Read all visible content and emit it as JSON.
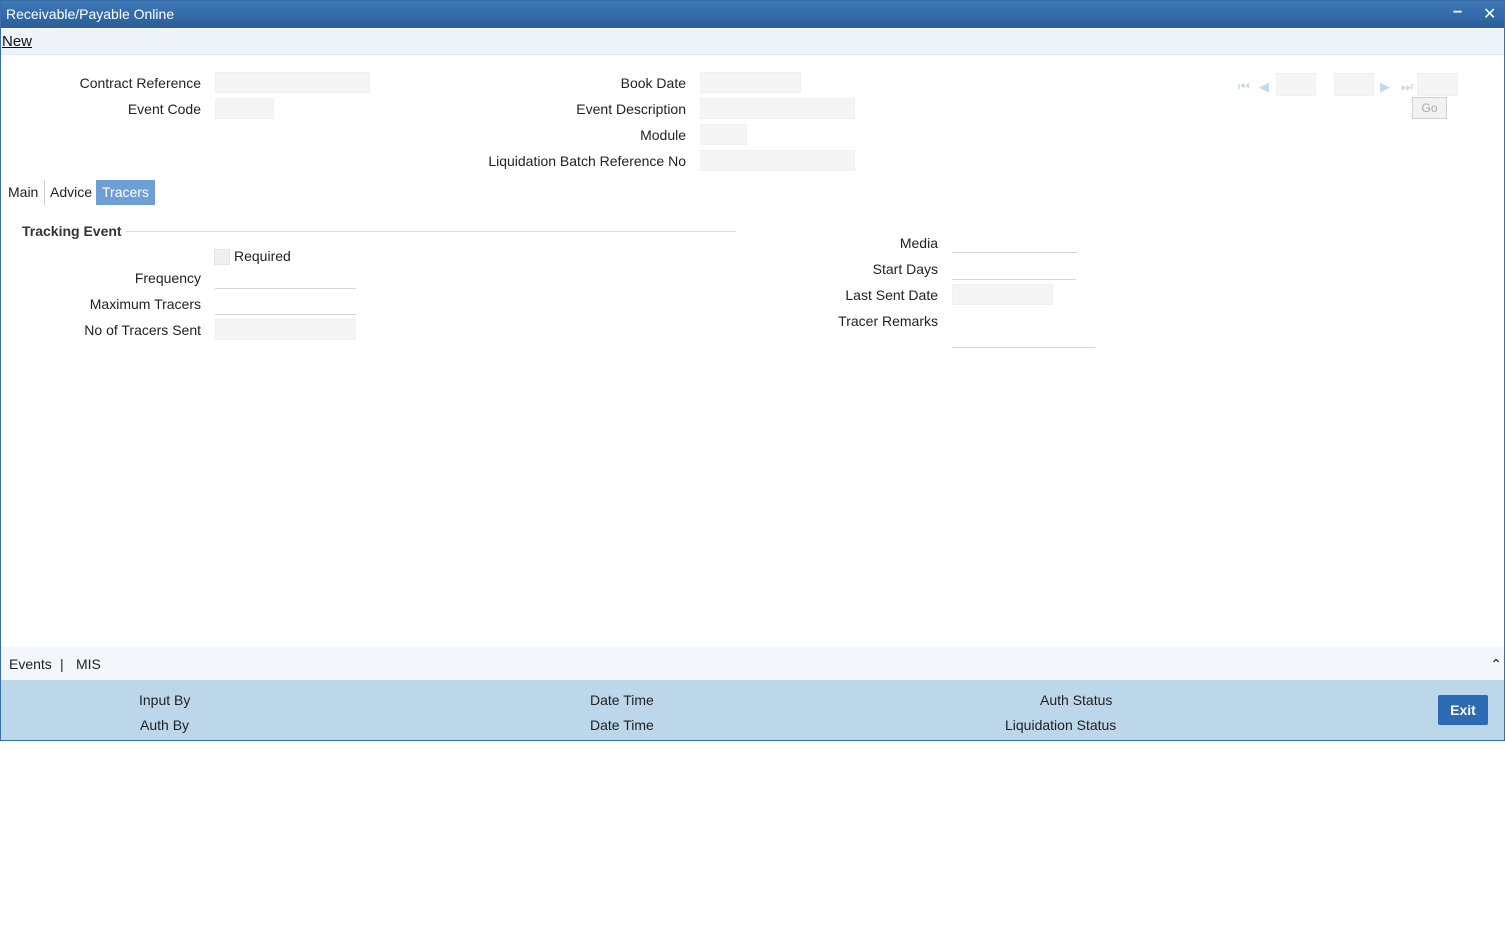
{
  "window": {
    "title": "Receivable/Payable Online",
    "minimize_glyph": "−",
    "close_glyph": "✕"
  },
  "menu": {
    "new_label": "New"
  },
  "header": {
    "contract_reference_label": "Contract Reference",
    "event_code_label": "Event Code",
    "book_date_label": "Book Date",
    "event_description_label": "Event Description",
    "module_label": "Module",
    "liquidation_batch_label": "Liquidation Batch Reference No",
    "contract_reference": "",
    "event_code": "",
    "book_date": "",
    "event_description": "",
    "module": "",
    "liquidation_batch": ""
  },
  "pager": {
    "current": "",
    "total": "",
    "goto": "",
    "go_label": "Go"
  },
  "tabs": [
    {
      "label": "Main"
    },
    {
      "label": "Advice"
    },
    {
      "label": "Tracers"
    }
  ],
  "tracers": {
    "section_title": "Tracking Event",
    "required_label": "Required",
    "required_checked": false,
    "frequency_label": "Frequency",
    "max_tracers_label": "Maximum Tracers",
    "tracers_sent_label": "No of Tracers Sent",
    "media_label": "Media",
    "start_days_label": "Start Days",
    "last_sent_date_label": "Last Sent Date",
    "tracer_remarks_label": "Tracer Remarks",
    "frequency": "",
    "max_tracers": "",
    "tracers_sent": "",
    "media": "",
    "start_days": "",
    "last_sent_date": "",
    "tracer_remarks": ""
  },
  "bottom_tabs": {
    "events": "Events",
    "separator": "|",
    "mis": "MIS"
  },
  "footer": {
    "input_by_label": "Input By",
    "auth_by_label": "Auth By",
    "date_time_label_1": "Date Time",
    "date_time_label_2": "Date Time",
    "auth_status_label": "Auth Status",
    "liquidation_status_label": "Liquidation Status",
    "exit_label": "Exit"
  },
  "colors": {
    "title_bar": "#2f67a6",
    "active_tab": "#6d9fd6",
    "footer": "#bcd6ea",
    "exit_button": "#2c6ab3"
  }
}
